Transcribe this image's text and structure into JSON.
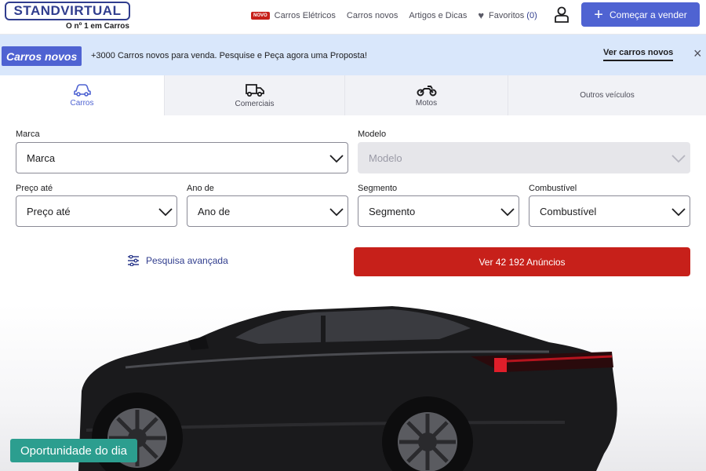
{
  "header": {
    "logo_text": "STANDVIRTUAL",
    "tagline": "O nº 1 em Carros",
    "nav": {
      "novo_badge": "NOVO",
      "items": [
        "Carros Elétricos",
        "Carros novos",
        "Artigos e Dicas"
      ],
      "favorites_label": "Favoritos",
      "favorites_count": "(0)"
    },
    "cta_label": "Começar a vender"
  },
  "promo": {
    "badge": "Carros novos",
    "text": "+3000 Carros novos para venda. Pesquise e Peça agora uma Proposta!",
    "link": "Ver carros novos",
    "close": "×"
  },
  "tabs": [
    {
      "label": "Carros",
      "icon": "car-icon",
      "active": true
    },
    {
      "label": "Comerciais",
      "icon": "van-icon",
      "active": false
    },
    {
      "label": "Motos",
      "icon": "motorcycle-icon",
      "active": false
    },
    {
      "label": "Outros veículos",
      "icon": "",
      "active": false
    }
  ],
  "form": {
    "marca": {
      "label": "Marca",
      "value": "Marca"
    },
    "modelo": {
      "label": "Modelo",
      "value": "Modelo",
      "disabled": true
    },
    "preco": {
      "label": "Preço até",
      "value": "Preço até"
    },
    "ano": {
      "label": "Ano de",
      "value": "Ano de"
    },
    "segmento": {
      "label": "Segmento",
      "value": "Segmento"
    },
    "combustivel": {
      "label": "Combustível",
      "value": "Combustível"
    },
    "advanced_label": "Pesquisa avançada",
    "submit_label": "Ver 42 192 Anúncios"
  },
  "hero": {
    "badge": "Oportunidade do dia"
  },
  "colors": {
    "brand": "#303d8e",
    "accent": "#4f63d2",
    "submit": "#c7201a",
    "promo_bg": "#d9e7fb",
    "opportunity": "#2c9e8f"
  }
}
